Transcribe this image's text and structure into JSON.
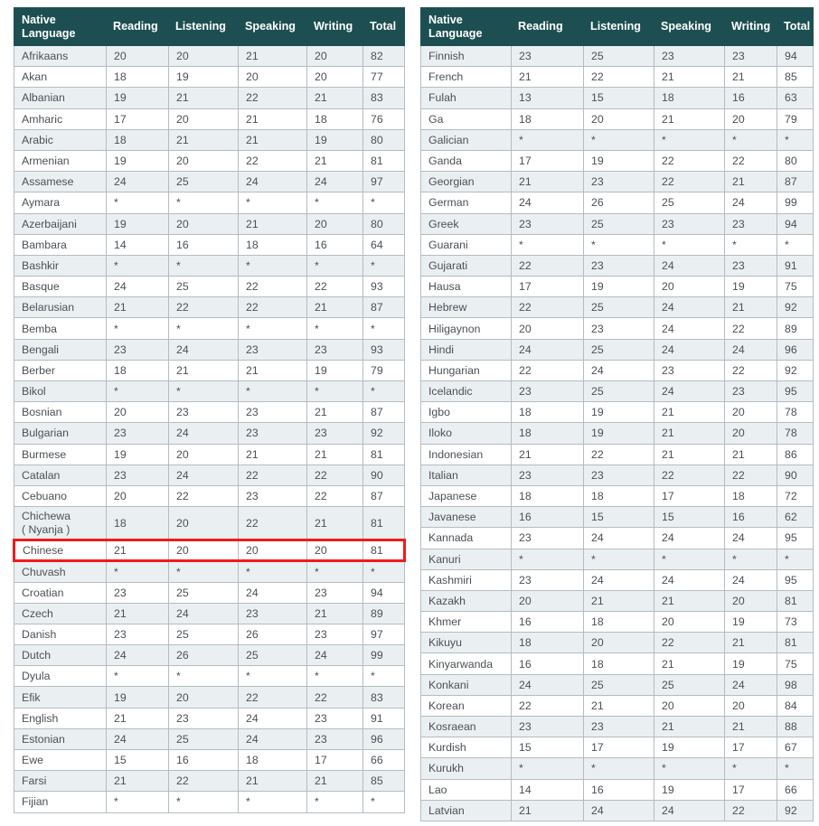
{
  "columns": [
    "Native Language",
    "Reading",
    "Listening",
    "Speaking",
    "Writing",
    "Total"
  ],
  "colors": {
    "header_bg": "#1d4f52",
    "header_text": "#ffffff",
    "row_alt_bg": "#eaf0f2",
    "row_bg": "#ffffff",
    "grid": "#b4bcc2",
    "text": "#4a5055",
    "highlight": "#ee1c1c"
  },
  "missing_value_symbol": "*",
  "highlighted_language": "Chinese",
  "chart_data": {
    "type": "table",
    "title": "",
    "columns": [
      "Native Language",
      "Reading",
      "Listening",
      "Speaking",
      "Writing",
      "Total"
    ],
    "left_table": [
      {
        "language": "Afrikaans",
        "reading": "20",
        "listening": "20",
        "speaking": "21",
        "writing": "20",
        "total": "82"
      },
      {
        "language": "Akan",
        "reading": "18",
        "listening": "19",
        "speaking": "20",
        "writing": "20",
        "total": "77"
      },
      {
        "language": "Albanian",
        "reading": "19",
        "listening": "21",
        "speaking": "22",
        "writing": "21",
        "total": "83"
      },
      {
        "language": "Amharic",
        "reading": "17",
        "listening": "20",
        "speaking": "21",
        "writing": "18",
        "total": "76"
      },
      {
        "language": "Arabic",
        "reading": "18",
        "listening": "21",
        "speaking": "21",
        "writing": "19",
        "total": "80"
      },
      {
        "language": "Armenian",
        "reading": "19",
        "listening": "20",
        "speaking": "22",
        "writing": "21",
        "total": "81"
      },
      {
        "language": "Assamese",
        "reading": "24",
        "listening": "25",
        "speaking": "24",
        "writing": "24",
        "total": "97"
      },
      {
        "language": "Aymara",
        "reading": "*",
        "listening": "*",
        "speaking": "*",
        "writing": "*",
        "total": "*"
      },
      {
        "language": "Azerbaijani",
        "reading": "19",
        "listening": "20",
        "speaking": "21",
        "writing": "20",
        "total": "80"
      },
      {
        "language": "Bambara",
        "reading": "14",
        "listening": "16",
        "speaking": "18",
        "writing": "16",
        "total": "64"
      },
      {
        "language": "Bashkir",
        "reading": "*",
        "listening": "*",
        "speaking": "*",
        "writing": "*",
        "total": "*"
      },
      {
        "language": "Basque",
        "reading": "24",
        "listening": "25",
        "speaking": "22",
        "writing": "22",
        "total": "93"
      },
      {
        "language": "Belarusian",
        "reading": "21",
        "listening": "22",
        "speaking": "22",
        "writing": "21",
        "total": "87"
      },
      {
        "language": "Bemba",
        "reading": "*",
        "listening": "*",
        "speaking": "*",
        "writing": "*",
        "total": "*"
      },
      {
        "language": "Bengali",
        "reading": "23",
        "listening": "24",
        "speaking": "23",
        "writing": "23",
        "total": "93"
      },
      {
        "language": "Berber",
        "reading": "18",
        "listening": "21",
        "speaking": "21",
        "writing": "19",
        "total": "79"
      },
      {
        "language": "Bikol",
        "reading": "*",
        "listening": "*",
        "speaking": "*",
        "writing": "*",
        "total": "*"
      },
      {
        "language": "Bosnian",
        "reading": "20",
        "listening": "23",
        "speaking": "23",
        "writing": "21",
        "total": "87"
      },
      {
        "language": "Bulgarian",
        "reading": "23",
        "listening": "24",
        "speaking": "23",
        "writing": "23",
        "total": "92"
      },
      {
        "language": "Burmese",
        "reading": "19",
        "listening": "20",
        "speaking": "21",
        "writing": "21",
        "total": "81"
      },
      {
        "language": "Catalan",
        "reading": "23",
        "listening": "24",
        "speaking": "22",
        "writing": "22",
        "total": "90"
      },
      {
        "language": "Cebuano",
        "reading": "20",
        "listening": "22",
        "speaking": "23",
        "writing": "22",
        "total": "87"
      },
      {
        "language": "Chichewa\n( Nyanja )",
        "reading": "18",
        "listening": "20",
        "speaking": "22",
        "writing": "21",
        "total": "81",
        "tall": true
      },
      {
        "language": "Chinese",
        "reading": "21",
        "listening": "20",
        "speaking": "20",
        "writing": "20",
        "total": "81",
        "highlight": true
      },
      {
        "language": "Chuvash",
        "reading": "*",
        "listening": "*",
        "speaking": "*",
        "writing": "*",
        "total": "*"
      },
      {
        "language": "Croatian",
        "reading": "23",
        "listening": "25",
        "speaking": "24",
        "writing": "23",
        "total": "94"
      },
      {
        "language": "Czech",
        "reading": "21",
        "listening": "24",
        "speaking": "23",
        "writing": "21",
        "total": "89"
      },
      {
        "language": "Danish",
        "reading": "23",
        "listening": "25",
        "speaking": "26",
        "writing": "23",
        "total": "97"
      },
      {
        "language": "Dutch",
        "reading": "24",
        "listening": "26",
        "speaking": "25",
        "writing": "24",
        "total": "99"
      },
      {
        "language": "Dyula",
        "reading": "*",
        "listening": "*",
        "speaking": "*",
        "writing": "*",
        "total": "*"
      },
      {
        "language": "Efik",
        "reading": "19",
        "listening": "20",
        "speaking": "22",
        "writing": "22",
        "total": "83"
      },
      {
        "language": "English",
        "reading": "21",
        "listening": "23",
        "speaking": "24",
        "writing": "23",
        "total": "91"
      },
      {
        "language": "Estonian",
        "reading": "24",
        "listening": "25",
        "speaking": "24",
        "writing": "23",
        "total": "96"
      },
      {
        "language": "Ewe",
        "reading": "15",
        "listening": "16",
        "speaking": "18",
        "writing": "17",
        "total": "66"
      },
      {
        "language": "Farsi",
        "reading": "21",
        "listening": "22",
        "speaking": "21",
        "writing": "21",
        "total": "85"
      },
      {
        "language": "Fijian",
        "reading": "*",
        "listening": "*",
        "speaking": "*",
        "writing": "*",
        "total": "*"
      }
    ],
    "right_table": [
      {
        "language": "Finnish",
        "reading": "23",
        "listening": "25",
        "speaking": "23",
        "writing": "23",
        "total": "94"
      },
      {
        "language": "French",
        "reading": "21",
        "listening": "22",
        "speaking": "21",
        "writing": "21",
        "total": "85"
      },
      {
        "language": "Fulah",
        "reading": "13",
        "listening": "15",
        "speaking": "18",
        "writing": "16",
        "total": "63"
      },
      {
        "language": "Ga",
        "reading": "18",
        "listening": "20",
        "speaking": "21",
        "writing": "20",
        "total": "79"
      },
      {
        "language": "Galician",
        "reading": "*",
        "listening": "*",
        "speaking": "*",
        "writing": "*",
        "total": "*"
      },
      {
        "language": "Ganda",
        "reading": "17",
        "listening": "19",
        "speaking": "22",
        "writing": "22",
        "total": "80"
      },
      {
        "language": "Georgian",
        "reading": "21",
        "listening": "23",
        "speaking": "22",
        "writing": "21",
        "total": "87"
      },
      {
        "language": "German",
        "reading": "24",
        "listening": "26",
        "speaking": "25",
        "writing": "24",
        "total": "99"
      },
      {
        "language": "Greek",
        "reading": "23",
        "listening": "25",
        "speaking": "23",
        "writing": "23",
        "total": "94"
      },
      {
        "language": "Guarani",
        "reading": "*",
        "listening": "*",
        "speaking": "*",
        "writing": "*",
        "total": "*"
      },
      {
        "language": "Gujarati",
        "reading": "22",
        "listening": "23",
        "speaking": "24",
        "writing": "23",
        "total": "91"
      },
      {
        "language": "Hausa",
        "reading": "17",
        "listening": "19",
        "speaking": "20",
        "writing": "19",
        "total": "75"
      },
      {
        "language": "Hebrew",
        "reading": "22",
        "listening": "25",
        "speaking": "24",
        "writing": "21",
        "total": "92"
      },
      {
        "language": "Hiligaynon",
        "reading": "20",
        "listening": "23",
        "speaking": "24",
        "writing": "22",
        "total": "89"
      },
      {
        "language": "Hindi",
        "reading": "24",
        "listening": "25",
        "speaking": "24",
        "writing": "24",
        "total": "96"
      },
      {
        "language": "Hungarian",
        "reading": "22",
        "listening": "24",
        "speaking": "23",
        "writing": "22",
        "total": "92"
      },
      {
        "language": "Icelandic",
        "reading": "23",
        "listening": "25",
        "speaking": "24",
        "writing": "23",
        "total": "95"
      },
      {
        "language": "Igbo",
        "reading": "18",
        "listening": "19",
        "speaking": "21",
        "writing": "20",
        "total": "78"
      },
      {
        "language": "Iloko",
        "reading": "18",
        "listening": "19",
        "speaking": "21",
        "writing": "20",
        "total": "78"
      },
      {
        "language": "Indonesian",
        "reading": "21",
        "listening": "22",
        "speaking": "21",
        "writing": "21",
        "total": "86"
      },
      {
        "language": "Italian",
        "reading": "23",
        "listening": "23",
        "speaking": "22",
        "writing": "22",
        "total": "90"
      },
      {
        "language": "Japanese",
        "reading": "18",
        "listening": "18",
        "speaking": "17",
        "writing": "18",
        "total": "72"
      },
      {
        "language": "Javanese",
        "reading": "16",
        "listening": "15",
        "speaking": "15",
        "writing": "16",
        "total": "62"
      },
      {
        "language": "Kannada",
        "reading": "23",
        "listening": "24",
        "speaking": "24",
        "writing": "24",
        "total": "95"
      },
      {
        "language": "Kanuri",
        "reading": "*",
        "listening": "*",
        "speaking": "*",
        "writing": "*",
        "total": "*"
      },
      {
        "language": "Kashmiri",
        "reading": "23",
        "listening": "24",
        "speaking": "24",
        "writing": "24",
        "total": "95"
      },
      {
        "language": "Kazakh",
        "reading": "20",
        "listening": "21",
        "speaking": "21",
        "writing": "20",
        "total": "81"
      },
      {
        "language": "Khmer",
        "reading": "16",
        "listening": "18",
        "speaking": "20",
        "writing": "19",
        "total": "73"
      },
      {
        "language": "Kikuyu",
        "reading": "18",
        "listening": "20",
        "speaking": "22",
        "writing": "21",
        "total": "81"
      },
      {
        "language": "Kinyarwanda",
        "reading": "16",
        "listening": "18",
        "speaking": "21",
        "writing": "19",
        "total": "75"
      },
      {
        "language": "Konkani",
        "reading": "24",
        "listening": "25",
        "speaking": "25",
        "writing": "24",
        "total": "98"
      },
      {
        "language": "Korean",
        "reading": "22",
        "listening": "21",
        "speaking": "20",
        "writing": "20",
        "total": "84"
      },
      {
        "language": "Kosraean",
        "reading": "23",
        "listening": "23",
        "speaking": "21",
        "writing": "21",
        "total": "88"
      },
      {
        "language": "Kurdish",
        "reading": "15",
        "listening": "17",
        "speaking": "19",
        "writing": "17",
        "total": "67"
      },
      {
        "language": "Kurukh",
        "reading": "*",
        "listening": "*",
        "speaking": "*",
        "writing": "*",
        "total": "*"
      },
      {
        "language": "Lao",
        "reading": "14",
        "listening": "16",
        "speaking": "19",
        "writing": "17",
        "total": "66"
      },
      {
        "language": "Latvian",
        "reading": "21",
        "listening": "24",
        "speaking": "24",
        "writing": "22",
        "total": "92"
      }
    ]
  }
}
